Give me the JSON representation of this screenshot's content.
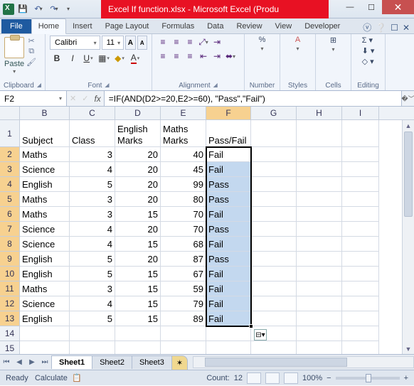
{
  "window": {
    "title": "Excel If function.xlsx - Microsoft Excel (Produ"
  },
  "qat": {
    "save": "💾",
    "undo": "↶",
    "redo": "↷"
  },
  "tabs": {
    "file": "File",
    "home": "Home",
    "insert": "Insert",
    "page_layout": "Page Layout",
    "formulas": "Formulas",
    "data": "Data",
    "review": "Review",
    "view": "View",
    "developer": "Developer"
  },
  "ribbon": {
    "paste": "Paste",
    "clipboard": "Clipboard",
    "font_name": "Calibri",
    "font_size": "11",
    "font": "Font",
    "alignment": "Alignment",
    "number": "Number",
    "styles": "Styles",
    "cells": "Cells",
    "editing": "Editing"
  },
  "namebox": "F2",
  "formula": "=IF(AND(D2>=20,E2>=60), \"Pass\",\"Fail\")",
  "columns": [
    "B",
    "C",
    "D",
    "E",
    "F",
    "G",
    "H",
    "I"
  ],
  "header_row": {
    "B": "Subject",
    "C": "Class",
    "D": "English Marks",
    "E": "Maths Marks",
    "F": "Pass/Fail"
  },
  "rows": [
    {
      "n": 2,
      "B": "Maths",
      "C": "3",
      "D": "20",
      "E": "40",
      "F": "Fail"
    },
    {
      "n": 3,
      "B": "Science",
      "C": "4",
      "D": "20",
      "E": "45",
      "F": "Fail"
    },
    {
      "n": 4,
      "B": "English",
      "C": "5",
      "D": "20",
      "E": "99",
      "F": "Pass"
    },
    {
      "n": 5,
      "B": "Maths",
      "C": "3",
      "D": "20",
      "E": "80",
      "F": "Pass"
    },
    {
      "n": 6,
      "B": "Maths",
      "C": "3",
      "D": "15",
      "E": "70",
      "F": "Fail"
    },
    {
      "n": 7,
      "B": "Science",
      "C": "4",
      "D": "20",
      "E": "70",
      "F": "Pass"
    },
    {
      "n": 8,
      "B": "Science",
      "C": "4",
      "D": "15",
      "E": "68",
      "F": "Fail"
    },
    {
      "n": 9,
      "B": "English",
      "C": "5",
      "D": "20",
      "E": "87",
      "F": "Pass"
    },
    {
      "n": 10,
      "B": "English",
      "C": "5",
      "D": "15",
      "E": "67",
      "F": "Fail"
    },
    {
      "n": 11,
      "B": "Maths",
      "C": "3",
      "D": "15",
      "E": "59",
      "F": "Fail"
    },
    {
      "n": 12,
      "B": "Science",
      "C": "4",
      "D": "15",
      "E": "79",
      "F": "Fail"
    },
    {
      "n": 13,
      "B": "English",
      "C": "5",
      "D": "15",
      "E": "89",
      "F": "Fail"
    }
  ],
  "sheets": {
    "s1": "Sheet1",
    "s2": "Sheet2",
    "s3": "Sheet3"
  },
  "status": {
    "ready": "Ready",
    "calc": "Calculate",
    "count_label": "Count:",
    "count": "12",
    "zoom": "100%"
  }
}
